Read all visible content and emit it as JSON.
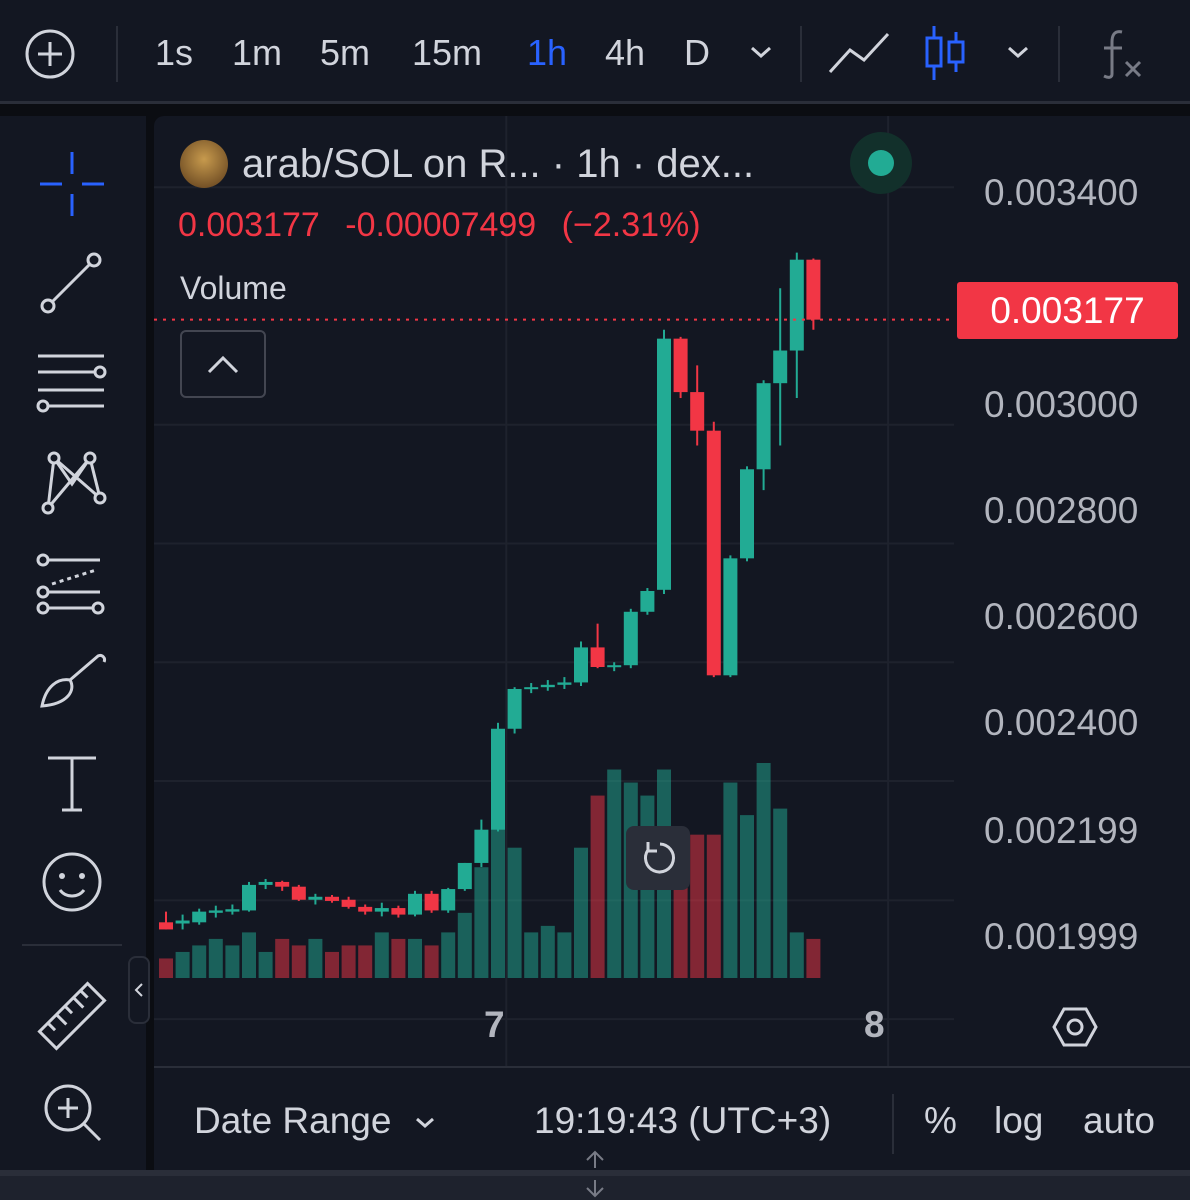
{
  "toolbar": {
    "timeframes": [
      "1s",
      "1m",
      "5m",
      "15m",
      "1h",
      "4h",
      "D"
    ],
    "active_timeframe": "1h",
    "accent_color": "#2962ff"
  },
  "sidebar": {
    "tools": [
      "crosshair-icon",
      "trend-line-icon",
      "horizontal-lines-icon",
      "pattern-icon",
      "fib-icon",
      "brush-icon",
      "text-icon",
      "emoji-icon",
      "ruler-icon",
      "zoom-in-icon"
    ]
  },
  "legend": {
    "title": "arab/SOL on R...  · 1h · dex...",
    "price": "0.003177",
    "change": "-0.00007499",
    "change_pct": "(−2.31%)",
    "volume_label": "Volume"
  },
  "price_axis": {
    "labels": [
      "0.003400",
      "0.003000",
      "0.002800",
      "0.002600",
      "0.002400",
      "0.002199",
      "0.001999"
    ],
    "current_price": "0.003177"
  },
  "time_axis": {
    "labels": [
      "7",
      "8"
    ]
  },
  "bottom_bar": {
    "date_range": "Date Range",
    "clock": "19:19:43 (UTC+3)",
    "percent": "%",
    "log": "log",
    "auto": "auto"
  },
  "colors": {
    "up": "#22ab94",
    "down": "#f23645",
    "bg": "#131722",
    "grid": "#1e222d"
  },
  "chart_data": {
    "type": "candlestick",
    "candles": [
      {
        "o": 0.002162,
        "h": 0.00218,
        "l": 0.00215,
        "c": 0.00215
      },
      {
        "o": 0.00216,
        "h": 0.002175,
        "l": 0.00215,
        "c": 0.002165
      },
      {
        "o": 0.002162,
        "h": 0.002185,
        "l": 0.002158,
        "c": 0.00218
      },
      {
        "o": 0.002178,
        "h": 0.00219,
        "l": 0.00217,
        "c": 0.002182
      },
      {
        "o": 0.00218,
        "h": 0.002192,
        "l": 0.002175,
        "c": 0.002184
      },
      {
        "o": 0.002182,
        "h": 0.00223,
        "l": 0.00218,
        "c": 0.002225
      },
      {
        "o": 0.002225,
        "h": 0.002235,
        "l": 0.002218,
        "c": 0.00223
      },
      {
        "o": 0.00223,
        "h": 0.002232,
        "l": 0.002215,
        "c": 0.002222
      },
      {
        "o": 0.002222,
        "h": 0.002225,
        "l": 0.002198,
        "c": 0.0022
      },
      {
        "o": 0.0022,
        "h": 0.00221,
        "l": 0.002192,
        "c": 0.002205
      },
      {
        "o": 0.002205,
        "h": 0.002208,
        "l": 0.002195,
        "c": 0.002198
      },
      {
        "o": 0.0022,
        "h": 0.002205,
        "l": 0.002185,
        "c": 0.002188
      },
      {
        "o": 0.002188,
        "h": 0.002192,
        "l": 0.002175,
        "c": 0.00218
      },
      {
        "o": 0.00218,
        "h": 0.002195,
        "l": 0.002172,
        "c": 0.002186
      },
      {
        "o": 0.002186,
        "h": 0.00219,
        "l": 0.00217,
        "c": 0.002175
      },
      {
        "o": 0.002175,
        "h": 0.002215,
        "l": 0.002172,
        "c": 0.00221
      },
      {
        "o": 0.00221,
        "h": 0.002215,
        "l": 0.002178,
        "c": 0.002182
      },
      {
        "o": 0.002182,
        "h": 0.00222,
        "l": 0.002178,
        "c": 0.002218
      },
      {
        "o": 0.002218,
        "h": 0.002262,
        "l": 0.002215,
        "c": 0.002262
      },
      {
        "o": 0.002262,
        "h": 0.002335,
        "l": 0.002255,
        "c": 0.002318
      },
      {
        "o": 0.002318,
        "h": 0.002498,
        "l": 0.002315,
        "c": 0.002488
      },
      {
        "o": 0.002488,
        "h": 0.002558,
        "l": 0.00248,
        "c": 0.002555
      },
      {
        "o": 0.002555,
        "h": 0.002565,
        "l": 0.002548,
        "c": 0.002558
      },
      {
        "o": 0.002558,
        "h": 0.00257,
        "l": 0.002552,
        "c": 0.002562
      },
      {
        "o": 0.002562,
        "h": 0.002575,
        "l": 0.002555,
        "c": 0.002566
      },
      {
        "o": 0.002566,
        "h": 0.002635,
        "l": 0.00256,
        "c": 0.002625
      },
      {
        "o": 0.002625,
        "h": 0.002665,
        "l": 0.00259,
        "c": 0.002592
      },
      {
        "o": 0.002592,
        "h": 0.0026,
        "l": 0.002585,
        "c": 0.002595
      },
      {
        "o": 0.002595,
        "h": 0.00269,
        "l": 0.00259,
        "c": 0.002685
      },
      {
        "o": 0.002685,
        "h": 0.002725,
        "l": 0.00268,
        "c": 0.00272
      },
      {
        "o": 0.002722,
        "h": 0.00316,
        "l": 0.002715,
        "c": 0.003145
      },
      {
        "o": 0.003145,
        "h": 0.003148,
        "l": 0.003045,
        "c": 0.003055
      },
      {
        "o": 0.003055,
        "h": 0.0031,
        "l": 0.002965,
        "c": 0.00299
      },
      {
        "o": 0.00299,
        "h": 0.003005,
        "l": 0.002575,
        "c": 0.002578
      },
      {
        "o": 0.002578,
        "h": 0.00278,
        "l": 0.002575,
        "c": 0.002775
      },
      {
        "o": 0.002775,
        "h": 0.00293,
        "l": 0.00277,
        "c": 0.002925
      },
      {
        "o": 0.002925,
        "h": 0.003075,
        "l": 0.00289,
        "c": 0.00307
      },
      {
        "o": 0.00307,
        "h": 0.00323,
        "l": 0.002965,
        "c": 0.003125
      },
      {
        "o": 0.003125,
        "h": 0.00329,
        "l": 0.003045,
        "c": 0.003278
      },
      {
        "o": 0.003278,
        "h": 0.00328,
        "l": 0.00316,
        "c": 0.003177
      }
    ],
    "volumes": [
      3,
      4,
      5,
      6,
      5,
      7,
      4,
      6,
      5,
      6,
      4,
      5,
      5,
      7,
      6,
      6,
      5,
      7,
      10,
      17,
      25,
      20,
      7,
      8,
      7,
      20,
      28,
      32,
      30,
      28,
      32,
      22,
      22,
      22,
      30,
      25,
      33,
      26,
      7,
      6
    ],
    "ylim": [
      0.00192,
      0.00352
    ],
    "xlabels": [
      {
        "label": "7",
        "index": 20.5
      },
      {
        "label": "8",
        "index": 43.5
      }
    ]
  }
}
